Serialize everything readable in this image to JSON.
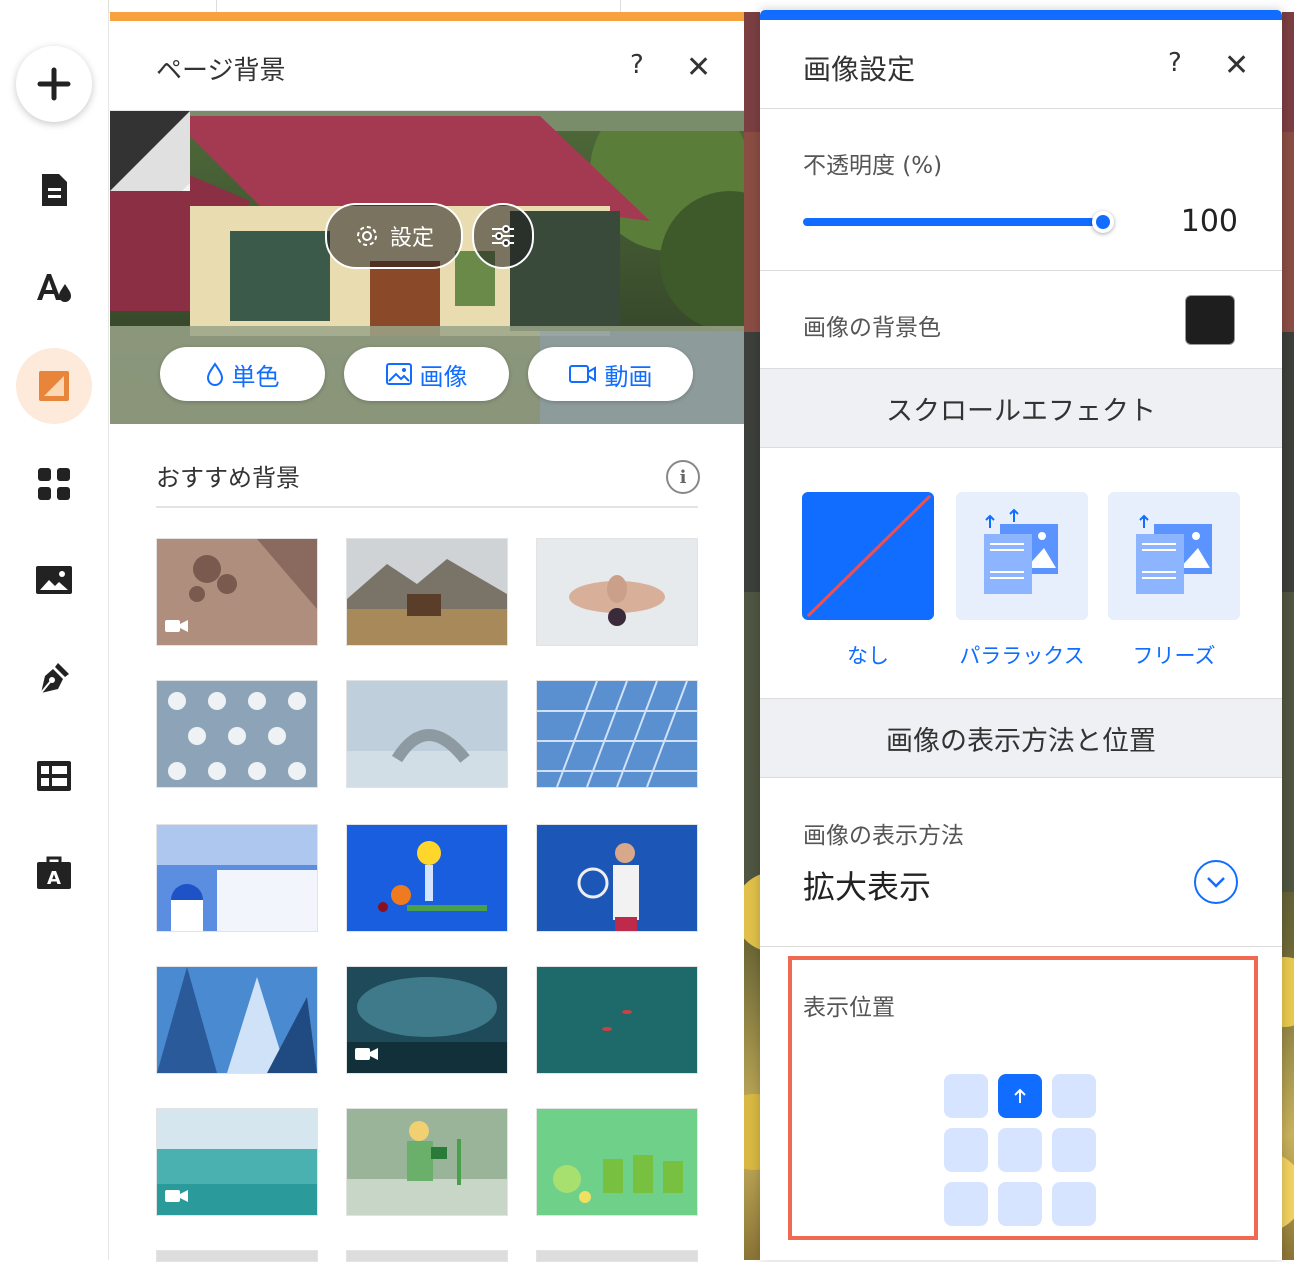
{
  "colors": {
    "accent_blue": "#116dff",
    "accent_orange": "#f7a23f",
    "highlight": "#ef6a50",
    "image_bg_color": "#1e1e1e"
  },
  "toolbar": {
    "items": [
      {
        "name": "add-icon"
      },
      {
        "name": "pages-icon"
      },
      {
        "name": "design-icon"
      },
      {
        "name": "background-icon"
      },
      {
        "name": "apps-icon"
      },
      {
        "name": "media-icon"
      },
      {
        "name": "pen-icon"
      },
      {
        "name": "table-icon"
      },
      {
        "name": "portfolio-icon"
      }
    ]
  },
  "page_bg": {
    "title": "ページ背景",
    "help": "?",
    "close": "✕",
    "settings_label": "設定",
    "types": {
      "color": "単色",
      "image": "画像",
      "video": "動画"
    },
    "recommended_title": "おすすめ背景",
    "info": "i",
    "thumbnails": [
      {
        "id": "shadow-plant",
        "video": true
      },
      {
        "id": "mountain-cabin",
        "video": false
      },
      {
        "id": "yoga-figure",
        "video": false
      },
      {
        "id": "milk-glasses",
        "video": false
      },
      {
        "id": "backbend-figure",
        "video": false
      },
      {
        "id": "glass-building",
        "video": false
      },
      {
        "id": "santorini",
        "video": false
      },
      {
        "id": "lemon-still-life",
        "video": false
      },
      {
        "id": "tennis-player",
        "video": false
      },
      {
        "id": "skyscrapers",
        "video": false
      },
      {
        "id": "storm-clouds",
        "video": true
      },
      {
        "id": "ocean-aerial",
        "video": false
      },
      {
        "id": "sea-horizon",
        "video": true
      },
      {
        "id": "reading-woman",
        "video": false
      },
      {
        "id": "green-juice",
        "video": false
      }
    ]
  },
  "image_settings": {
    "title": "画像設定",
    "help": "?",
    "close": "✕",
    "opacity_label": "不透明度 (%)",
    "opacity_value": "100",
    "bg_color_label": "画像の背景色",
    "scroll_effect_title": "スクロールエフェクト",
    "effects": [
      {
        "label": "なし",
        "selected": true
      },
      {
        "label": "パララックス",
        "selected": false
      },
      {
        "label": "フリーズ",
        "selected": false
      }
    ],
    "display_section_title": "画像の表示方法と位置",
    "display_method_label": "画像の表示方法",
    "display_method_value": "拡大表示",
    "position_label": "表示位置",
    "position_selected": "top-center"
  }
}
